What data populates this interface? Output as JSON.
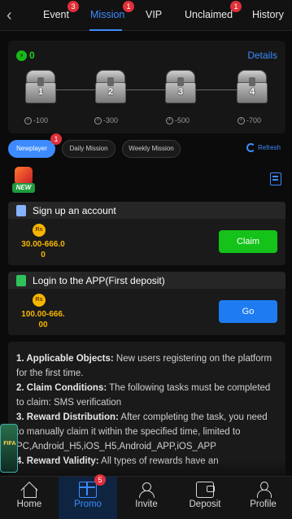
{
  "tabs": [
    {
      "label": "Event",
      "badge": "3"
    },
    {
      "label": "Mission",
      "badge": "1",
      "active": true
    },
    {
      "label": "VIP"
    },
    {
      "label": "Unclaimed",
      "badge": "1"
    },
    {
      "label": "History"
    }
  ],
  "progress": {
    "coin_value": "0",
    "details_label": "Details",
    "chests": [
      {
        "number": "1",
        "cost": "-100"
      },
      {
        "number": "2",
        "cost": "-300"
      },
      {
        "number": "3",
        "cost": "-500"
      },
      {
        "number": "4",
        "cost": "-700"
      }
    ]
  },
  "filters": {
    "newplayer": "Newplayer",
    "newplayer_badge": "1",
    "daily": "Daily Mission",
    "weekly": "Weekly Mission",
    "refresh": "Refresh"
  },
  "new_label": "NEW",
  "tasks": [
    {
      "title": "Sign up an account",
      "coin_symbol": "Rs",
      "amount_line1": "30.00-666.0",
      "amount_line2": "0",
      "button": "Claim",
      "button_color": "#14c21a"
    },
    {
      "title": "Login to the APP(First deposit)",
      "coin_symbol": "Rs",
      "amount_line1": "100.00-666.",
      "amount_line2": "00",
      "button": "Go",
      "button_color": "#1e7bf2"
    }
  ],
  "rules": [
    {
      "heading": "1. Applicable Objects:",
      "text": " New users registering on the platform for the first time."
    },
    {
      "heading": "2. Claim Conditions:",
      "text": " The following tasks must be completed to claim: SMS verification"
    },
    {
      "heading": "3. Reward Distribution:",
      "text": " After completing the task, you need to manually claim it within the specified time, limited to PC,Android_H5,iOS_H5,Android_APP,iOS_APP"
    },
    {
      "heading": "4. Reward Validity:",
      "text": " All types of rewards have an"
    }
  ],
  "promo_label": "FIFA",
  "bottom_nav": [
    {
      "label": "Home"
    },
    {
      "label": "Promo",
      "badge": "5",
      "active": true
    },
    {
      "label": "Invite"
    },
    {
      "label": "Deposit"
    },
    {
      "label": "Profile"
    }
  ],
  "colors": {
    "accent": "#3d8bff",
    "coin_green": "#1fd21f",
    "reward_gold": "#f6b500",
    "badge_red": "#e0303a"
  }
}
